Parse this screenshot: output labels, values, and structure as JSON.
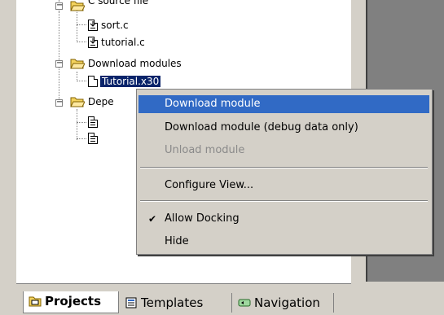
{
  "tree": {
    "group_c_source": {
      "label": "C source file"
    },
    "file_sort": {
      "label": "sort.c"
    },
    "file_tutorial": {
      "label": "tutorial.c"
    },
    "group_download": {
      "label": "Download modules"
    },
    "file_tutorial_x30": {
      "label": "Tutorial.x30"
    },
    "group_dependencies": {
      "label": "Depe"
    }
  },
  "context_menu": {
    "download_module": "Download module",
    "download_module_debug": "Download module (debug data only)",
    "unload_module": "Unload module",
    "configure_view": "Configure View...",
    "allow_docking": "Allow Docking",
    "allow_docking_checked": true,
    "hide": "Hide"
  },
  "tabs": {
    "projects": "Projects",
    "templates": "Templates",
    "navigation": "Navigation"
  },
  "colors": {
    "menu_highlight": "#316ac5",
    "selection": "#0a246a",
    "folder_yellow": "#f4d35e"
  }
}
